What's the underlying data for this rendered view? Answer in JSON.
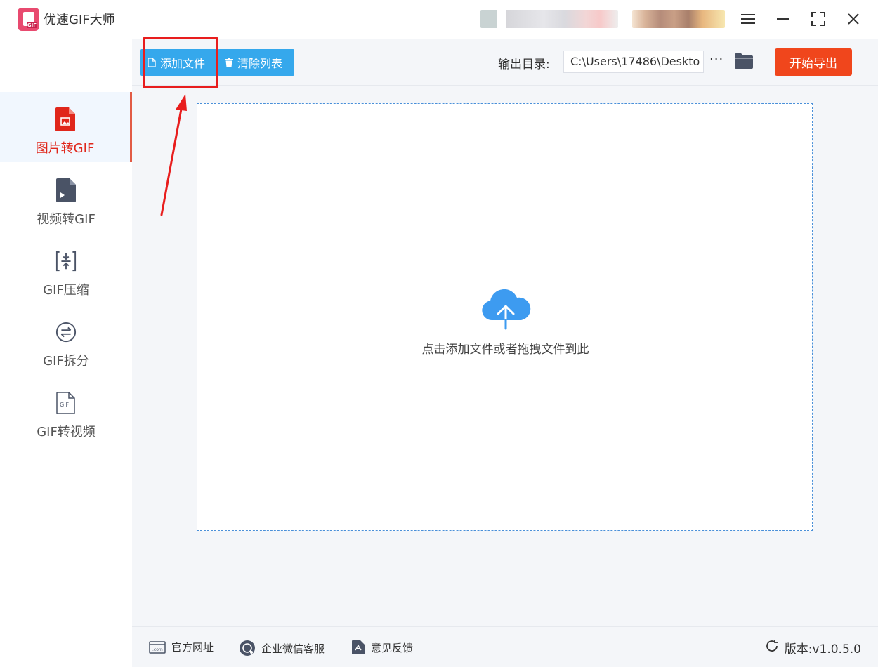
{
  "app": {
    "title": "优速GIF大师",
    "logo_tag": "GIF"
  },
  "window_controls": {
    "menu_icon": "hamburger-icon",
    "minimize_icon": "minimize-icon",
    "maximize_icon": "maximize-icon",
    "close_icon": "close-icon"
  },
  "sidebar": {
    "items": [
      {
        "label": "图片转GIF",
        "icon": "image-file-icon",
        "active": true
      },
      {
        "label": "视频转GIF",
        "icon": "video-file-icon",
        "active": false
      },
      {
        "label": "GIF压缩",
        "icon": "compress-icon",
        "active": false
      },
      {
        "label": "GIF拆分",
        "icon": "split-icon",
        "active": false
      },
      {
        "label": "GIF转视频",
        "icon": "gif-file-icon",
        "active": false
      }
    ]
  },
  "toolbar": {
    "add_file_label": "添加文件",
    "clear_list_label": "清除列表",
    "output_label": "输出目录:",
    "output_path": "C:\\Users\\17486\\Deskto",
    "more_label": "···",
    "start_export_label": "开始导出"
  },
  "dropzone": {
    "hint": "点击添加文件或者拖拽文件到此"
  },
  "footer": {
    "website_label": "官方网址",
    "wechat_label": "企业微信客服",
    "feedback_label": "意见反馈",
    "version_label": "版本:v1.0.5.0"
  },
  "colors": {
    "accent_blue": "#35a8ec",
    "export_red": "#f0461c",
    "active_red": "#e0271b",
    "highlight_box": "#e81d1d"
  }
}
